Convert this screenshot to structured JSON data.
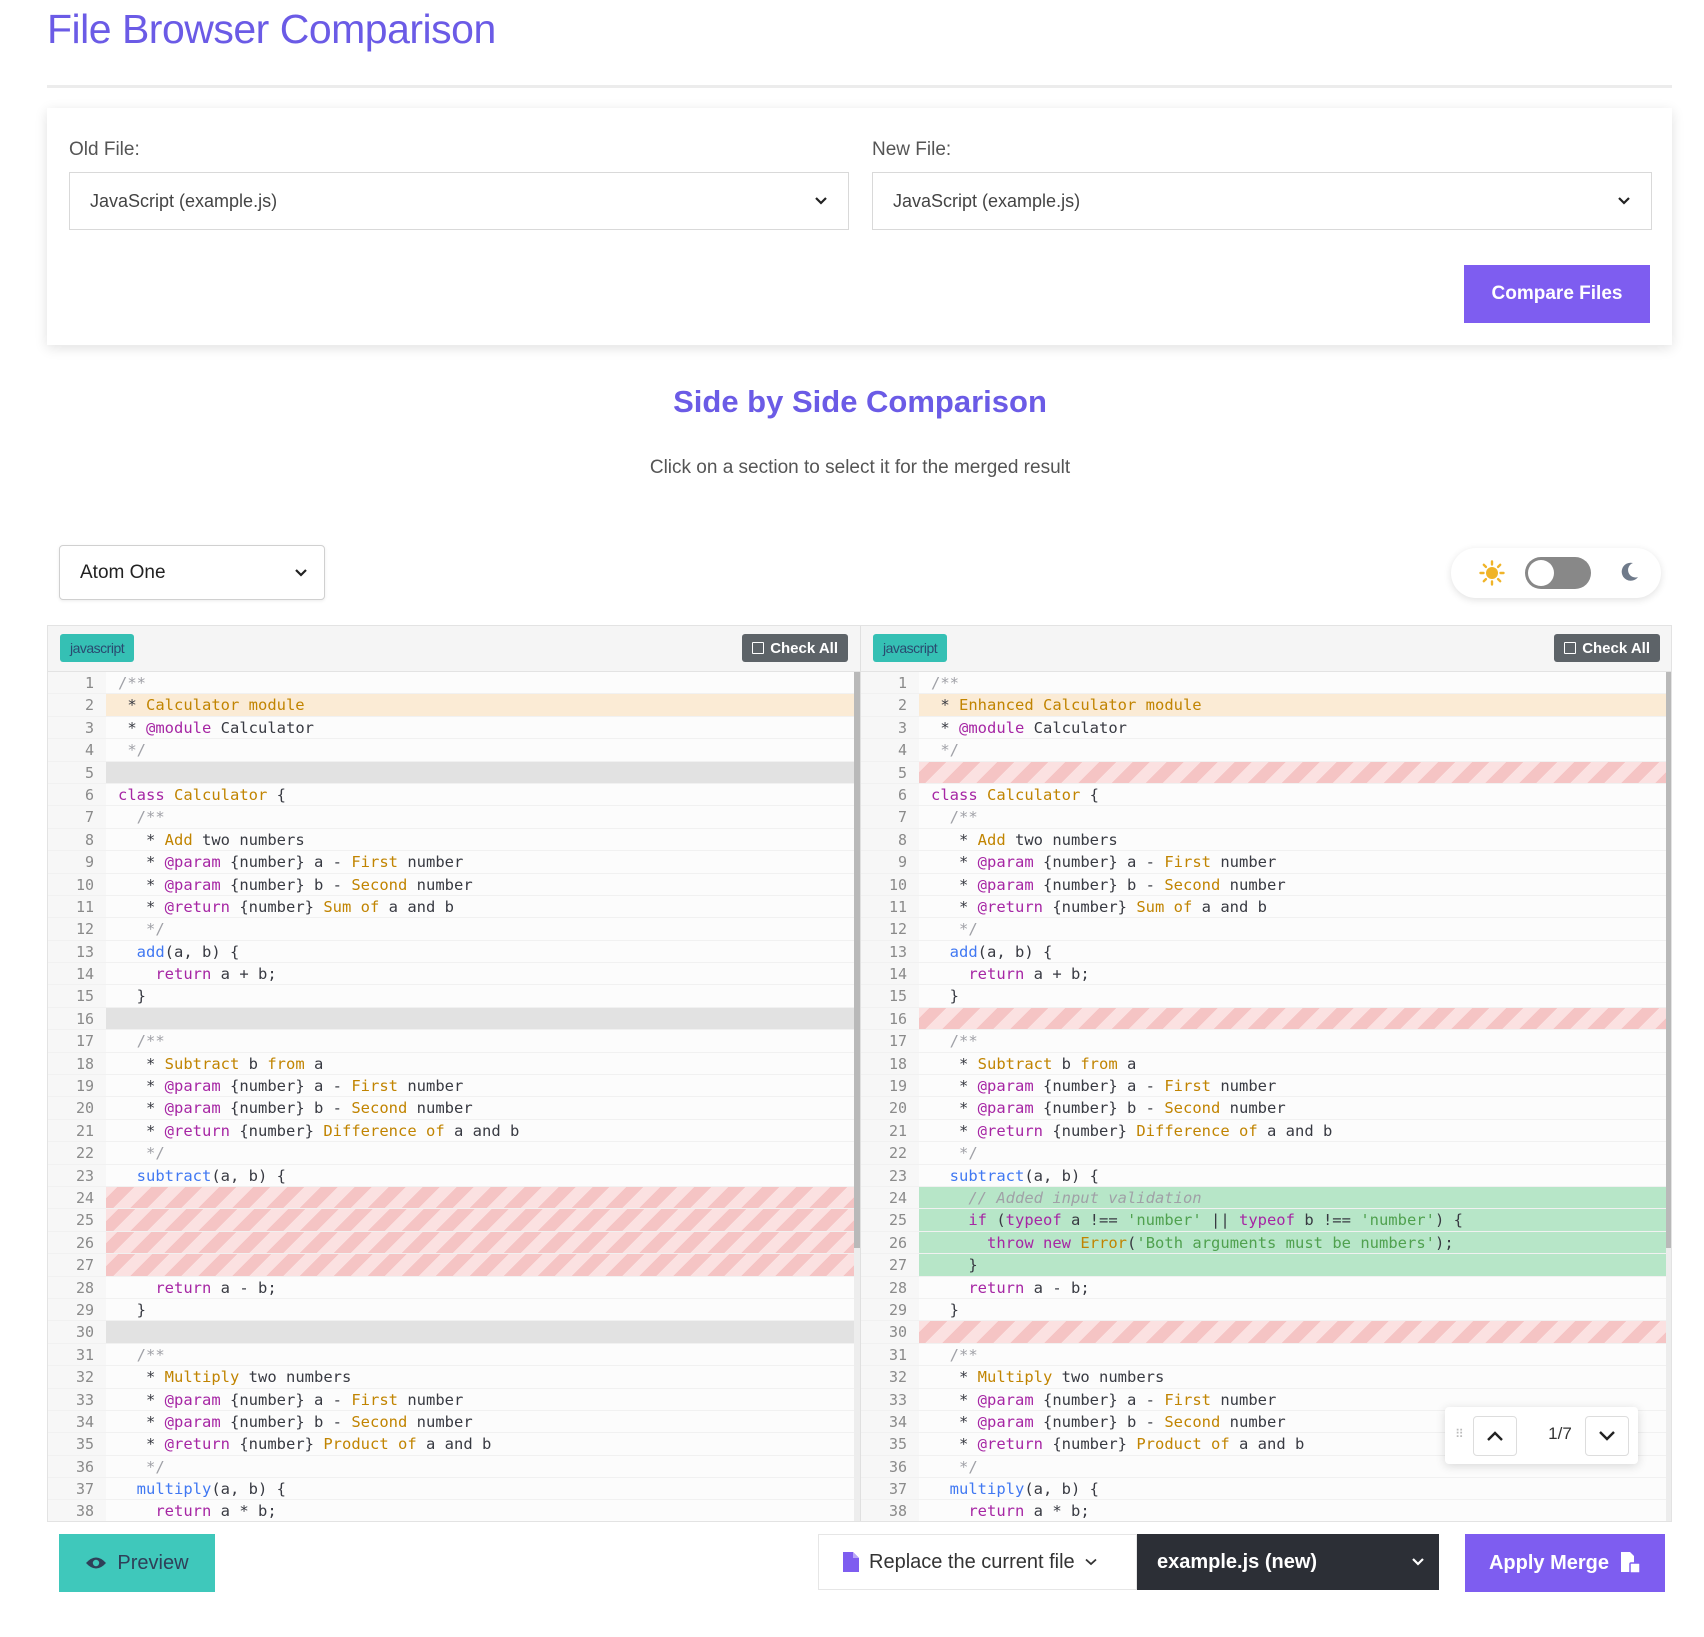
{
  "page": {
    "title": "File Browser Comparison"
  },
  "file_select": {
    "old_label": "Old File:",
    "old_value": "JavaScript (example.js)",
    "new_label": "New File:",
    "new_value": "JavaScript (example.js)",
    "compare_label": "Compare Files"
  },
  "comparison": {
    "title": "Side by Side Comparison",
    "subtitle": "Click on a section to select it for the merged result",
    "theme_value": "Atom One",
    "dark_mode": false
  },
  "panes": {
    "left": {
      "language": "javascript",
      "check_all_label": "Check All",
      "lines": [
        {
          "n": "1",
          "t": "/**",
          "s": ""
        },
        {
          "n": "2",
          "t": " * Calculator module",
          "s": "changed"
        },
        {
          "n": "3",
          "t": " * @module Calculator",
          "s": ""
        },
        {
          "n": "4",
          "t": " */",
          "s": ""
        },
        {
          "n": "5",
          "t": "",
          "s": "gap"
        },
        {
          "n": "6",
          "t": "class Calculator {",
          "s": ""
        },
        {
          "n": "7",
          "t": "  /**",
          "s": ""
        },
        {
          "n": "8",
          "t": "   * Add two numbers",
          "s": ""
        },
        {
          "n": "9",
          "t": "   * @param {number} a - First number",
          "s": ""
        },
        {
          "n": "10",
          "t": "   * @param {number} b - Second number",
          "s": ""
        },
        {
          "n": "11",
          "t": "   * @return {number} Sum of a and b",
          "s": ""
        },
        {
          "n": "12",
          "t": "   */",
          "s": ""
        },
        {
          "n": "13",
          "t": "  add(a, b) {",
          "s": ""
        },
        {
          "n": "14",
          "t": "    return a + b;",
          "s": ""
        },
        {
          "n": "15",
          "t": "  }",
          "s": ""
        },
        {
          "n": "16",
          "t": "",
          "s": "gap"
        },
        {
          "n": "17",
          "t": "  /**",
          "s": ""
        },
        {
          "n": "18",
          "t": "   * Subtract b from a",
          "s": ""
        },
        {
          "n": "19",
          "t": "   * @param {number} a - First number",
          "s": ""
        },
        {
          "n": "20",
          "t": "   * @param {number} b - Second number",
          "s": ""
        },
        {
          "n": "21",
          "t": "   * @return {number} Difference of a and b",
          "s": ""
        },
        {
          "n": "22",
          "t": "   */",
          "s": ""
        },
        {
          "n": "23",
          "t": "  subtract(a, b) {",
          "s": ""
        },
        {
          "n": "24",
          "t": "",
          "s": "removed"
        },
        {
          "n": "25",
          "t": "",
          "s": "removed"
        },
        {
          "n": "26",
          "t": "",
          "s": "removed"
        },
        {
          "n": "27",
          "t": "",
          "s": "removed"
        },
        {
          "n": "28",
          "t": "    return a - b;",
          "s": ""
        },
        {
          "n": "29",
          "t": "  }",
          "s": ""
        },
        {
          "n": "30",
          "t": "",
          "s": "gap"
        },
        {
          "n": "31",
          "t": "  /**",
          "s": ""
        },
        {
          "n": "32",
          "t": "   * Multiply two numbers",
          "s": ""
        },
        {
          "n": "33",
          "t": "   * @param {number} a - First number",
          "s": ""
        },
        {
          "n": "34",
          "t": "   * @param {number} b - Second number",
          "s": ""
        },
        {
          "n": "35",
          "t": "   * @return {number} Product of a and b",
          "s": ""
        },
        {
          "n": "36",
          "t": "   */",
          "s": ""
        },
        {
          "n": "37",
          "t": "  multiply(a, b) {",
          "s": ""
        },
        {
          "n": "38",
          "t": "    return a * b;",
          "s": ""
        }
      ]
    },
    "right": {
      "language": "javascript",
      "check_all_label": "Check All",
      "lines": [
        {
          "n": "1",
          "t": "/**",
          "s": ""
        },
        {
          "n": "2",
          "t": " * Enhanced Calculator module",
          "s": "changed"
        },
        {
          "n": "3",
          "t": " * @module Calculator",
          "s": ""
        },
        {
          "n": "4",
          "t": " */",
          "s": ""
        },
        {
          "n": "5",
          "t": "",
          "s": "removed"
        },
        {
          "n": "6",
          "t": "class Calculator {",
          "s": ""
        },
        {
          "n": "7",
          "t": "  /**",
          "s": ""
        },
        {
          "n": "8",
          "t": "   * Add two numbers",
          "s": ""
        },
        {
          "n": "9",
          "t": "   * @param {number} a - First number",
          "s": ""
        },
        {
          "n": "10",
          "t": "   * @param {number} b - Second number",
          "s": ""
        },
        {
          "n": "11",
          "t": "   * @return {number} Sum of a and b",
          "s": ""
        },
        {
          "n": "12",
          "t": "   */",
          "s": ""
        },
        {
          "n": "13",
          "t": "  add(a, b) {",
          "s": ""
        },
        {
          "n": "14",
          "t": "    return a + b;",
          "s": ""
        },
        {
          "n": "15",
          "t": "  }",
          "s": ""
        },
        {
          "n": "16",
          "t": "",
          "s": "removed"
        },
        {
          "n": "17",
          "t": "  /**",
          "s": ""
        },
        {
          "n": "18",
          "t": "   * Subtract b from a",
          "s": ""
        },
        {
          "n": "19",
          "t": "   * @param {number} a - First number",
          "s": ""
        },
        {
          "n": "20",
          "t": "   * @param {number} b - Second number",
          "s": ""
        },
        {
          "n": "21",
          "t": "   * @return {number} Difference of a and b",
          "s": ""
        },
        {
          "n": "22",
          "t": "   */",
          "s": ""
        },
        {
          "n": "23",
          "t": "  subtract(a, b) {",
          "s": ""
        },
        {
          "n": "24",
          "t": "    // Added input validation",
          "s": "added"
        },
        {
          "n": "25",
          "t": "    if (typeof a !== 'number' || typeof b !== 'number') {",
          "s": "added"
        },
        {
          "n": "26",
          "t": "      throw new Error('Both arguments must be numbers');",
          "s": "added"
        },
        {
          "n": "27",
          "t": "    }",
          "s": "added"
        },
        {
          "n": "28",
          "t": "    return a - b;",
          "s": ""
        },
        {
          "n": "29",
          "t": "  }",
          "s": ""
        },
        {
          "n": "30",
          "t": "",
          "s": "removed"
        },
        {
          "n": "31",
          "t": "  /**",
          "s": ""
        },
        {
          "n": "32",
          "t": "   * Multiply two numbers",
          "s": ""
        },
        {
          "n": "33",
          "t": "   * @param {number} a - First number",
          "s": ""
        },
        {
          "n": "34",
          "t": "   * @param {number} b - Second number",
          "s": ""
        },
        {
          "n": "35",
          "t": "   * @return {number} Product of a and b",
          "s": ""
        },
        {
          "n": "36",
          "t": "   */",
          "s": ""
        },
        {
          "n": "37",
          "t": "  multiply(a, b) {",
          "s": ""
        },
        {
          "n": "38",
          "t": "    return a * b;",
          "s": ""
        }
      ]
    }
  },
  "hunk_nav": {
    "counter": "1/7"
  },
  "footer": {
    "preview_label": "Preview",
    "replace_label": "Replace the current file",
    "target_file": "example.js (new)",
    "apply_label": "Apply Merge"
  },
  "colors": {
    "accent": "#7e5df0",
    "title": "#6b5be6",
    "teal": "#3fc8bb",
    "added": "#b7e6c8",
    "changed": "#fbebd5",
    "removed": "#f5c4c4"
  },
  "icons": [
    "sun-icon",
    "moon-icon",
    "eye-icon",
    "file-icon",
    "chevron-down-icon",
    "merge-icon",
    "chevron-up-icon",
    "drag-handle-icon"
  ]
}
